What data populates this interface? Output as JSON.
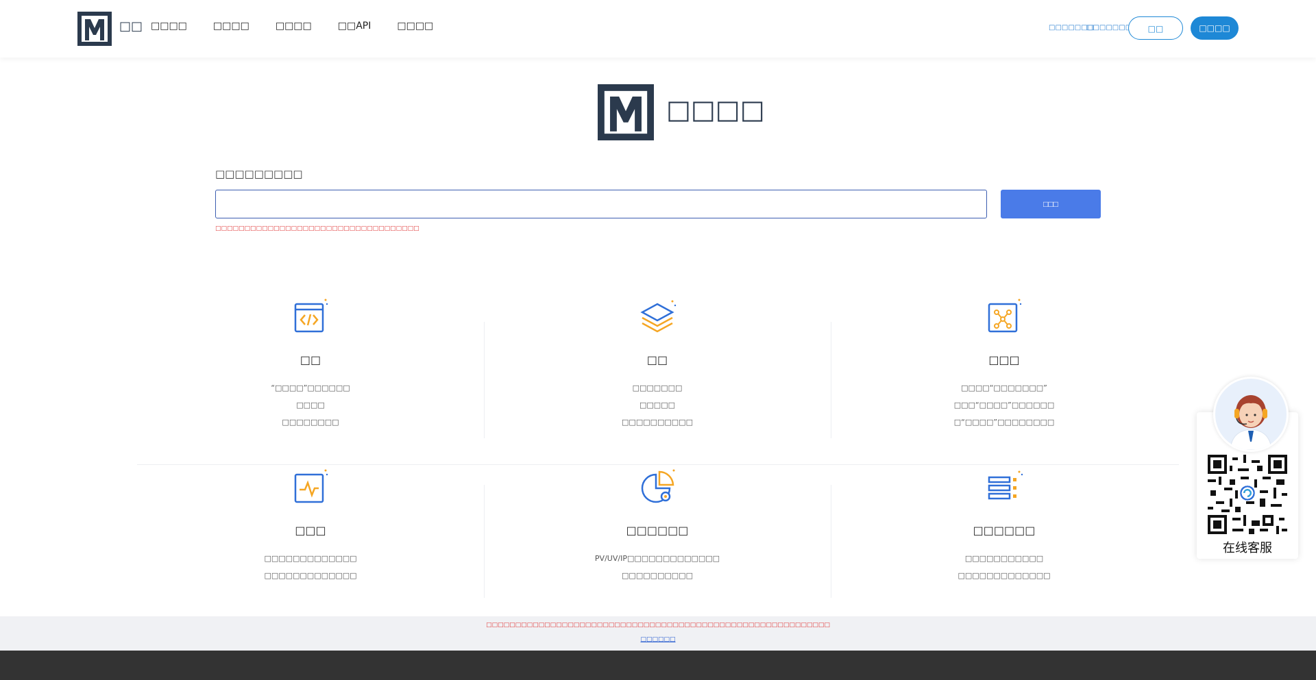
{
  "brand": {
    "name": "□□"
  },
  "nav": [
    {
      "label": "□□□□"
    },
    {
      "label": "□□□□"
    },
    {
      "label": "□□□□"
    },
    {
      "label": "□□API"
    },
    {
      "label": "□□□□"
    }
  ],
  "top_links": [
    "□□□□□□□",
    "□□□□□□□"
  ],
  "auth": {
    "login_label": "□□",
    "register_label": "□□□□"
  },
  "hero": {
    "title": "□□□□"
  },
  "search": {
    "label": "□□□□□□□□□",
    "value": "",
    "button_label": "□□□",
    "hint": "□□□□□□□□□□□□□□□□□□□□□□□□□□□□□□□□□□□"
  },
  "features": [
    {
      "title": "□□",
      "lines": [
        "“□□□□”□□□□□□",
        "□□□□",
        "□□□□□□□□"
      ],
      "icon": "code-window-icon"
    },
    {
      "title": "□□",
      "lines": [
        "□□□□□□□",
        "□□□□□",
        "□□□□□□□□□□"
      ],
      "icon": "layers-icon"
    },
    {
      "title": "□□□",
      "lines": [
        "□□□□“□□□□□□□”",
        "□□□“□□□□”□□□□□□",
        "□“□□□□”□□□□□□□□"
      ],
      "icon": "network-nodes-icon"
    },
    {
      "title": "□□□",
      "lines": [
        "□□□□□□□□□□□□□",
        "□□□□□□□□□□□□□"
      ],
      "icon": "monitor-pulse-icon"
    },
    {
      "title": "□□□□□□",
      "lines": [
        "PV/UV/IP□□□□□□□□□□□□□",
        "□□□□□□□□□□"
      ],
      "icon": "pie-chart-icon"
    },
    {
      "title": "□□□□□□",
      "lines": [
        "□□□□□□□□□□□",
        "□□□□□□□□□□□□□"
      ],
      "icon": "list-grid-icon"
    }
  ],
  "customer_service": {
    "label": "在线客服"
  },
  "notice": {
    "text": "□□□□□□□□□□□□□□□□□□□□□□□□□□□□□□□□□□□□□□□□□□□□□□□□□□□□□□□□□□□",
    "link_label": "□□□□□□"
  },
  "colors": {
    "brand_dark": "#2b3a4d",
    "primary": "#1e88d6",
    "search_button": "#4a7be8",
    "icon_blue": "#2f6fd8",
    "icon_orange": "#f5a623",
    "warning": "#e03a3a",
    "footer": "#333333"
  }
}
